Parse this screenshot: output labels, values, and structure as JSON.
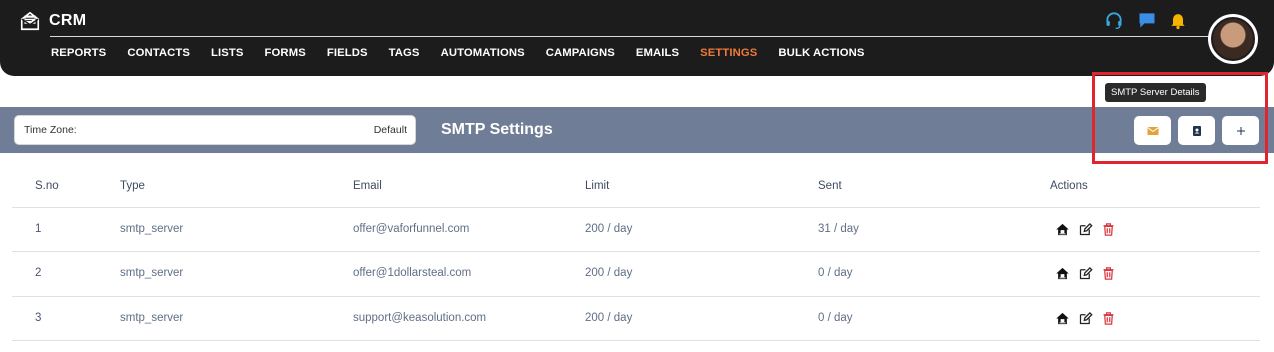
{
  "app": {
    "name": "CRM"
  },
  "nav": [
    {
      "label": "REPORTS",
      "active": false
    },
    {
      "label": "CONTACTS",
      "active": false
    },
    {
      "label": "LISTS",
      "active": false
    },
    {
      "label": "FORMS",
      "active": false
    },
    {
      "label": "FIELDS",
      "active": false
    },
    {
      "label": "TAGS",
      "active": false
    },
    {
      "label": "AUTOMATIONS",
      "active": false
    },
    {
      "label": "CAMPAIGNS",
      "active": false
    },
    {
      "label": "EMAILS",
      "active": false
    },
    {
      "label": "SETTINGS",
      "active": true
    },
    {
      "label": "BULK ACTIONS",
      "active": false
    }
  ],
  "top_icons": [
    "headset-icon",
    "chat-icon",
    "bell-icon"
  ],
  "colors": {
    "accent": "#ee7a3a",
    "band": "#6f7e96",
    "highlight": "#e0252e",
    "delete": "#d9363e"
  },
  "tooltip": "SMTP Server Details",
  "toolbar": {
    "timezone_label": "Time Zone:",
    "timezone_value": "Default",
    "title": "SMTP Settings",
    "buttons": [
      "smtp-server-details-button",
      "contact-card-button",
      "add-button"
    ]
  },
  "table": {
    "headers": {
      "sno": "S.no",
      "type": "Type",
      "email": "Email",
      "limit": "Limit",
      "sent": "Sent",
      "actions": "Actions"
    },
    "rows": [
      {
        "sno": "1",
        "type": "smtp_server",
        "email": "offer@vaforfunnel.com",
        "limit": "200 / day",
        "sent": "31 / day"
      },
      {
        "sno": "2",
        "type": "smtp_server",
        "email": "offer@1dollarsteal.com",
        "limit": "200 / day",
        "sent": "0 / day"
      },
      {
        "sno": "3",
        "type": "smtp_server",
        "email": "support@keasolution.com",
        "limit": "200 / day",
        "sent": "0 / day"
      }
    ]
  }
}
